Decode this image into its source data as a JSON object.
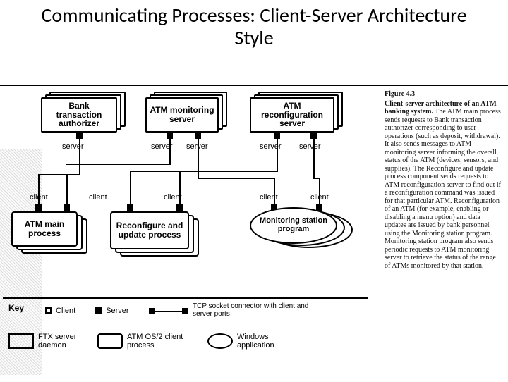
{
  "title": "Communicating Processes: Client-Server Architecture Style",
  "caption": {
    "fig_label": "Figure 4.3",
    "fig_title": "Client-server architecture of an ATM banking system.",
    "body": "The ATM main process sends requests to Bank transaction authorizer corresponding to user operations (such as deposit, withdrawal). It also sends messages to ATM monitoring server informing the overall status of the ATM (devices, sensors, and supplies). The Reconfigure and update process component sends requests to ATM reconfiguration server to find out if a reconfiguration command was issued for that particular ATM. Reconfiguration of an ATM (for example, enabling or disabling a menu option) and data updates are issued by bank personnel using the Monitoring station program. Monitoring station program also sends periodic requests to ATM monitoring server to retrieve the status of the range of ATMs monitored by that station."
  },
  "nodes": {
    "bank_auth": "Bank transaction authorizer",
    "mon_server": "ATM monitoring server",
    "reconf_server": "ATM reconfiguration server",
    "atm_main": "ATM main process",
    "reconf_proc": "Reconfigure and update process",
    "mon_station": "Monitoring station program"
  },
  "port_labels": {
    "server": "server",
    "client": "client"
  },
  "key": {
    "heading": "Key",
    "client": "Client",
    "server": "Server",
    "tcp": "TCP socket connector with client and server ports",
    "ftx": "FTX server daemon",
    "atmos2": "ATM OS/2 client process",
    "windows": "Windows application"
  }
}
